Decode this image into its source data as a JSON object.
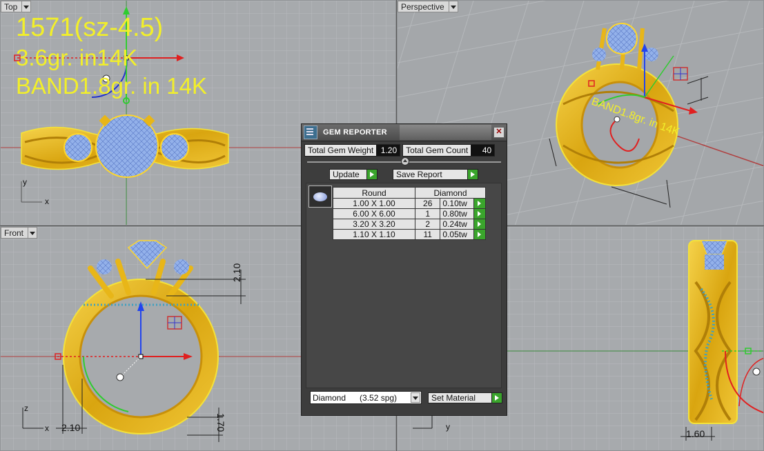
{
  "viewports": {
    "top": {
      "label": "Top"
    },
    "perspective": {
      "label": "Perspective"
    },
    "front": {
      "label": "Front"
    }
  },
  "annotations": {
    "line1": "1571(sz-4.5)",
    "line2": "3.6gr. in14K",
    "line3": "BAND1.8gr.  in 14K"
  },
  "dimensions": {
    "front_top": "2.10",
    "front_left": "2.10",
    "front_right": "1.70",
    "side_bottom": "1.60"
  },
  "axis_labels": {
    "top_y": "y",
    "top_x": "x",
    "front_z": "z",
    "front_x": "x",
    "side_y": "y"
  },
  "gem_reporter": {
    "title": "GEM REPORTER",
    "close_glyph": "✕",
    "total_weight_label": "Total Gem Weight",
    "total_weight_value": "1.20",
    "total_count_label": "Total Gem Count",
    "total_count_value": "40",
    "update_label": "Update",
    "save_label": "Save Report",
    "columns": [
      "Round",
      "Diamond"
    ],
    "rows": [
      {
        "size": "1.00 X 1.00",
        "count": "26",
        "weight": "0.10tw"
      },
      {
        "size": "6.00 X 6.00",
        "count": "1",
        "weight": "0.80tw"
      },
      {
        "size": "3.20 X 3.20",
        "count": "2",
        "weight": "0.24tw"
      },
      {
        "size": "1.10 X 1.10",
        "count": "11",
        "weight": "0.05tw"
      }
    ],
    "material_select": "Diamond      (3.52 spg)",
    "set_material_label": "Set Material"
  },
  "icons": {
    "title_icon": "gem-report-icon",
    "gem_thumbnail": "round-gem-icon"
  },
  "colors": {
    "gold": "#e8b618",
    "gem_blue": "#8fb0ec",
    "annotation_yellow": "#f2ef2a",
    "axis_red": "#e02020",
    "axis_green": "#2fcc2f",
    "axis_blue": "#2244ee",
    "viewport_bg": "#a7aaad"
  }
}
